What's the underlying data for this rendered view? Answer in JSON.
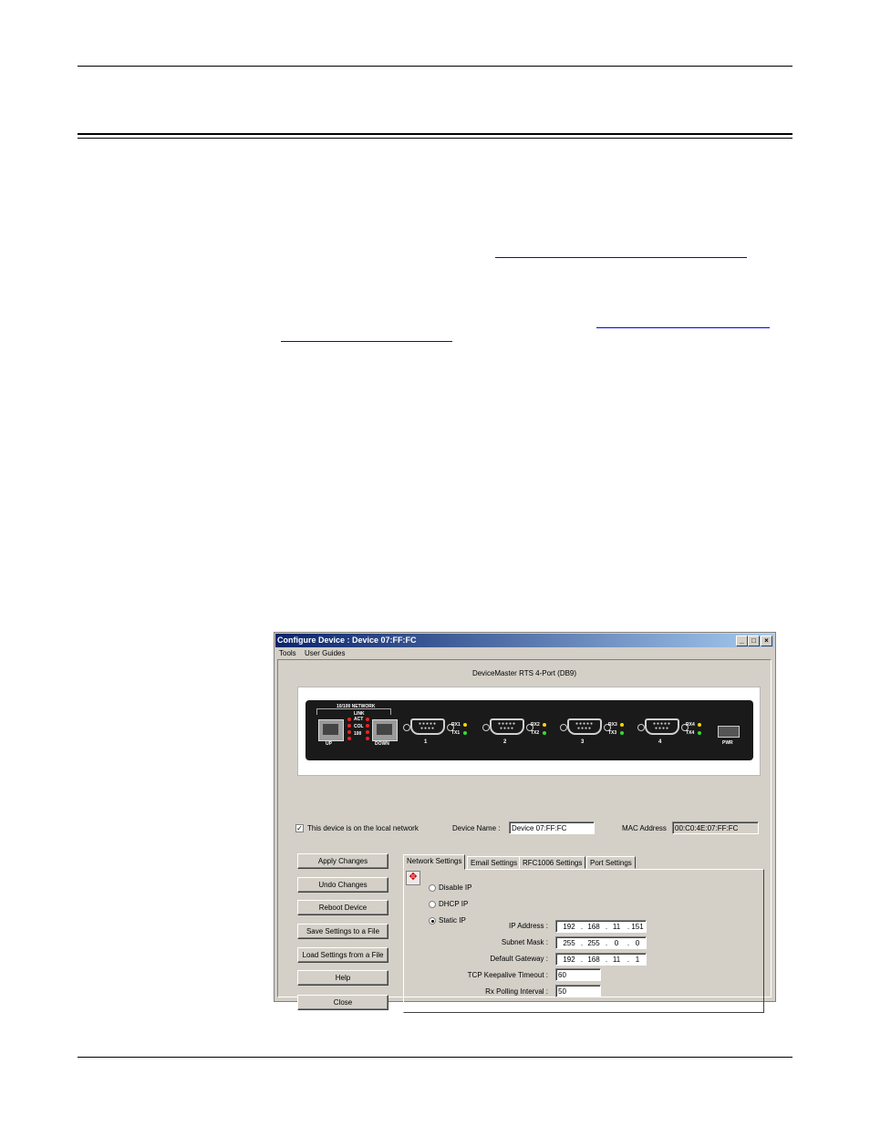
{
  "window": {
    "title": "Configure Device : Device 07:FF:FC",
    "minimize_glyph": "_",
    "maximize_glyph": "□",
    "close_glyph": "×"
  },
  "menu": [
    "Tools",
    "User Guides"
  ],
  "device": {
    "model": "DeviceMaster RTS 4-Port (DB9)",
    "network_label": "10/100 NETWORK",
    "led_labels": [
      "LINK",
      "ACT",
      "COL",
      "100"
    ],
    "port_up": "UP",
    "port_down": "DOWN",
    "ports": [
      {
        "num": "1",
        "rx": "RX1",
        "tx": "TX1"
      },
      {
        "num": "2",
        "rx": "RX2",
        "tx": "TX2"
      },
      {
        "num": "3",
        "rx": "RX3",
        "tx": "TX3"
      },
      {
        "num": "4",
        "rx": "RX4",
        "tx": "TX4"
      }
    ],
    "pwr": "PWR"
  },
  "local_network": {
    "label": "This device is on the local network",
    "checked": true,
    "check_glyph": "✓"
  },
  "device_name": {
    "label": "Device Name :",
    "value": "Device 07:FF:FC"
  },
  "mac_address": {
    "label": "MAC Address",
    "value": "00:C0:4E:07:FF:FC"
  },
  "buttons": [
    "Apply Changes",
    "Undo Changes",
    "Reboot Device",
    "Save Settings to a File",
    "Load Settings from a File",
    "Help",
    "Close"
  ],
  "tabs": [
    "Network Settings",
    "Email Settings",
    "RFC1006 Settings",
    "Port Settings"
  ],
  "network": {
    "move_glyph": "✥",
    "modes": [
      "Disable IP",
      "DHCP IP",
      "Static IP"
    ],
    "selected_mode": "Static IP",
    "ip_address": {
      "label": "IP Address :",
      "octets": [
        "192",
        "168",
        "11",
        "151"
      ]
    },
    "subnet_mask": {
      "label": "Subnet Mask :",
      "octets": [
        "255",
        "255",
        "0",
        "0"
      ]
    },
    "default_gateway": {
      "label": "Default Gateway :",
      "octets": [
        "192",
        "168",
        "11",
        "1"
      ]
    },
    "tcp_keepalive": {
      "label": "TCP Keepalive Timeout :",
      "value": "60"
    },
    "rx_polling": {
      "label": "Rx Polling Interval :",
      "value": "50"
    }
  },
  "colors": {
    "titlebar_start": "#0a246a",
    "titlebar_end": "#a6caf0",
    "face": "#d4d0c8",
    "led_yellow": "#ffd400",
    "led_green": "#33dd33",
    "led_red": "#ee2222",
    "link": "#0000ff"
  }
}
